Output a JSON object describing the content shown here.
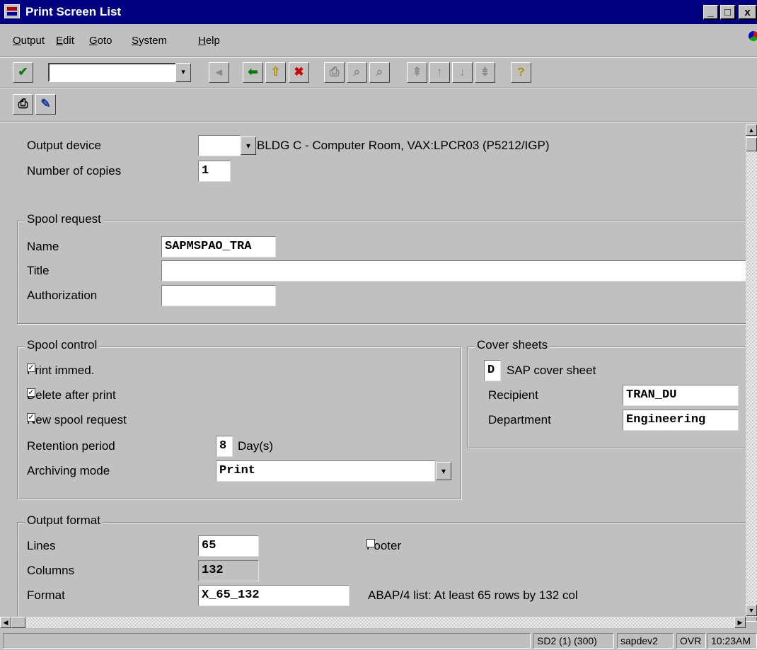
{
  "window": {
    "title": "Print Screen List",
    "minimize": "_",
    "maximize": "□",
    "close": "x"
  },
  "menu": [
    "Output",
    "Edit",
    "Goto",
    "System",
    "Help"
  ],
  "toolbar": {
    "enter_icon": "✔",
    "command_value": "",
    "dropdown_icon": "▾",
    "back_icon": "⬅",
    "exit_icon": "⇧",
    "cancel_icon": "✖",
    "help_icon": "?"
  },
  "app_toolbar": {
    "print_icon": "🖶",
    "edit_icon": "✎"
  },
  "output": {
    "device_label": "Output device",
    "device_value": "",
    "device_desc": "BLDG C - Computer Room, VAX:LPCR03 (P5212/IGP)",
    "copies_label": "Number of copies",
    "copies_value": "1"
  },
  "spool_request": {
    "title": "Spool request",
    "name_label": "Name",
    "name_value": "SAPMSPAO_TRA",
    "title_label": "Title",
    "title_value": "",
    "auth_label": "Authorization",
    "auth_value": ""
  },
  "spool_control": {
    "title": "Spool control",
    "print_immed": "Print immed.",
    "delete_after": "Delete after print",
    "new_spool": "New spool request",
    "check_mark": "✓",
    "retention_label": "Retention period",
    "retention_value": "8",
    "retention_unit": "Day(s)",
    "archiving_label": "Archiving mode",
    "archiving_value": "Print"
  },
  "cover_sheets": {
    "title": "Cover sheets",
    "sap_cover_value": "D",
    "sap_cover_label": "SAP cover sheet",
    "recipient_label": "Recipient",
    "recipient_value": "TRAN_DU",
    "department_label": "Department",
    "department_value": "Engineering"
  },
  "output_format": {
    "title": "Output format",
    "lines_label": "Lines",
    "lines_value": "65",
    "footer_label": "Footer",
    "columns_label": "Columns",
    "columns_value": "132",
    "format_label": "Format",
    "format_value": "X_65_132",
    "format_desc": "ABAP/4 list: At least 65 rows by 132 col"
  },
  "status": {
    "message": "",
    "system": "SD2 (1) (300)",
    "server": "sapdev2",
    "mode": "OVR",
    "time": "10:23AM"
  }
}
